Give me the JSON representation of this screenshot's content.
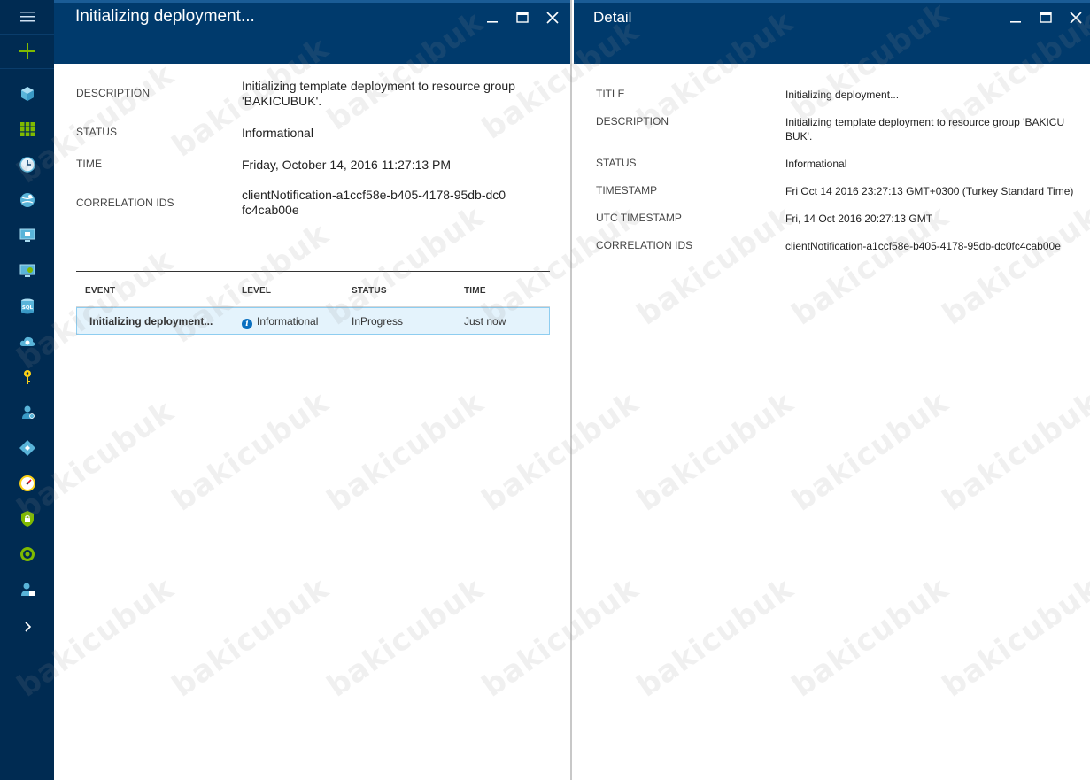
{
  "colors": {
    "nav_bg": "#002b52",
    "header_bg": "#003a6c",
    "accent_green": "#7fba00",
    "selected_row_bg": "#e4f3fc",
    "selected_row_border": "#8ecdf0",
    "info_blue": "#0a70c0"
  },
  "nav": {
    "items": [
      {
        "icon": "cube-icon"
      },
      {
        "icon": "grid-icon"
      },
      {
        "icon": "clock-icon"
      },
      {
        "icon": "globe-icon"
      },
      {
        "icon": "monitor-icon"
      },
      {
        "icon": "monitor-sync-icon"
      },
      {
        "icon": "sql-database-icon"
      },
      {
        "icon": "cloud-gear-icon"
      },
      {
        "icon": "key-icon"
      },
      {
        "icon": "flask-icon"
      },
      {
        "icon": "diamond-icon"
      },
      {
        "icon": "gauge-icon"
      },
      {
        "icon": "shield-lock-icon"
      },
      {
        "icon": "coin-icon"
      },
      {
        "icon": "user-lock-icon"
      }
    ],
    "sql_text": "SQL"
  },
  "left_blade": {
    "title": "Initializing deployment...",
    "properties": {
      "description_label": "DESCRIPTION",
      "description_value": "Initializing template deployment to resource group 'BAKICUBUK'.",
      "status_label": "STATUS",
      "status_value": "Informational",
      "time_label": "TIME",
      "time_value": "Friday, October 14, 2016 11:27:13 PM",
      "correlation_label": "CORRELATION IDS",
      "correlation_value": "clientNotification-a1ccf58e-b405-4178-95db-dc0fc4cab00e"
    },
    "events": {
      "headers": {
        "event": "EVENT",
        "level": "LEVEL",
        "status": "STATUS",
        "time": "TIME"
      },
      "rows": [
        {
          "event": "Initializing deployment...",
          "level": "Informational",
          "status": "InProgress",
          "time": "Just now"
        }
      ],
      "info_glyph": "i"
    }
  },
  "right_blade": {
    "title": "Detail",
    "fields": {
      "title_label": "TITLE",
      "title_value": "Initializing deployment...",
      "description_label": "DESCRIPTION",
      "description_value": "Initializing template deployment to resource group 'BAKICUBUK'.",
      "status_label": "STATUS",
      "status_value": "Informational",
      "timestamp_label": "TIMESTAMP",
      "timestamp_value": "Fri Oct 14 2016 23:27:13 GMT+0300 (Turkey Standard Time)",
      "utc_label": "UTC TIMESTAMP",
      "utc_value": "Fri, 14 Oct 2016 20:27:13 GMT",
      "correlation_label": "CORRELATION IDS",
      "correlation_value": "clientNotification-a1ccf58e-b405-4178-95db-dc0fc4cab00e"
    }
  },
  "watermark": "bakicubuk"
}
